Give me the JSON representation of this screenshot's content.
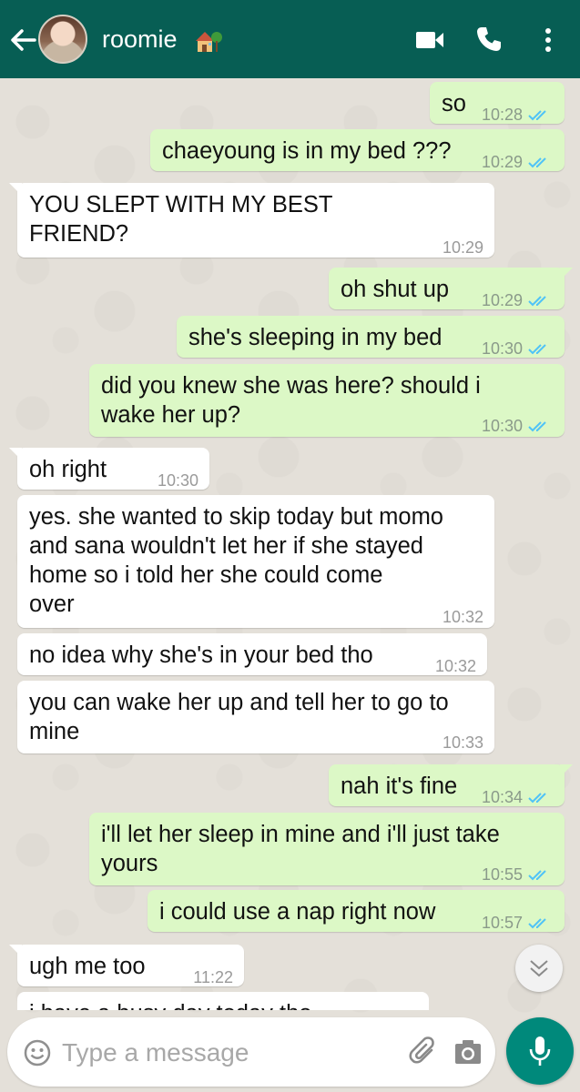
{
  "header": {
    "contact_name": "roomie",
    "contact_emoji": "house-with-garden-icon",
    "color": "#075e54"
  },
  "messages": [
    {
      "from": "me",
      "text": "so",
      "time": "10:28",
      "status": "read"
    },
    {
      "from": "me",
      "text": "chaeyoung is in my bed ???",
      "time": "10:29",
      "status": "read"
    },
    {
      "from": "them",
      "text": "YOU SLEPT WITH MY BEST\nFRIEND?",
      "time": "10:29"
    },
    {
      "from": "me",
      "text": "oh shut up",
      "time": "10:29",
      "status": "read"
    },
    {
      "from": "me",
      "text": "she's sleeping in my bed",
      "time": "10:30",
      "status": "read"
    },
    {
      "from": "me",
      "text": "did you knew she was here? should i\nwake her up?",
      "time": "10:30",
      "status": "read"
    },
    {
      "from": "them",
      "text": "oh right",
      "time": "10:30"
    },
    {
      "from": "them",
      "text": "yes. she wanted to skip today but momo\nand sana wouldn't let her if she stayed\nhome so i told her she could come\nover",
      "time": "10:32"
    },
    {
      "from": "them",
      "text": "no idea why she's in your bed tho",
      "time": "10:32"
    },
    {
      "from": "them",
      "text": "you can wake her up and tell her to go to\nmine",
      "time": "10:33"
    },
    {
      "from": "me",
      "text": "nah it's fine",
      "time": "10:34",
      "status": "read"
    },
    {
      "from": "me",
      "text": "i'll let her sleep in mine and i'll just take\nyours",
      "time": "10:55",
      "status": "read"
    },
    {
      "from": "me",
      "text": "i could use a nap right now",
      "time": "10:57",
      "status": "read"
    },
    {
      "from": "them",
      "text": "ugh me too",
      "time": "11:22"
    },
    {
      "from": "them",
      "text": "i have a busy day today tho",
      "time": ""
    }
  ],
  "composer": {
    "placeholder": "Type a message"
  },
  "colors": {
    "outgoing_bubble": "#dcf8c6",
    "incoming_bubble": "#ffffff",
    "read_ticks": "#4fc3f7",
    "mic_button": "#00897b"
  }
}
